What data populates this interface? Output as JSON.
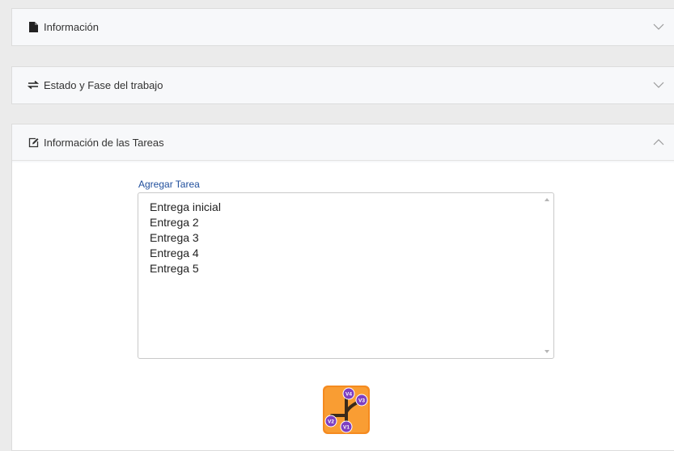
{
  "panels": {
    "info": {
      "title": "Información",
      "icon": "file-icon",
      "state": "collapsed"
    },
    "estado": {
      "title": "Estado y Fase del trabajo",
      "icon": "exchange-icon",
      "state": "collapsed"
    },
    "tareas": {
      "title": "Información de las Tareas",
      "icon": "edit-icon",
      "state": "expanded"
    }
  },
  "tareas": {
    "add_label": "Agregar Tarea",
    "items": [
      "Entrega inicial",
      "Entrega 2",
      "Entrega 3",
      "Entrega 4",
      "Entrega 5"
    ]
  },
  "logo": {
    "name": "version-tree-logo",
    "node_labels": [
      "V4",
      "V3",
      "V2",
      "V1"
    ],
    "colors": {
      "background": "#f58a1f",
      "node": "#7e3fc1",
      "line": "#3a2a1a"
    }
  },
  "colors": {
    "link": "#1f4e9c",
    "panel_header_bg": "#f7f8fa",
    "page_bg": "#ebebeb"
  }
}
